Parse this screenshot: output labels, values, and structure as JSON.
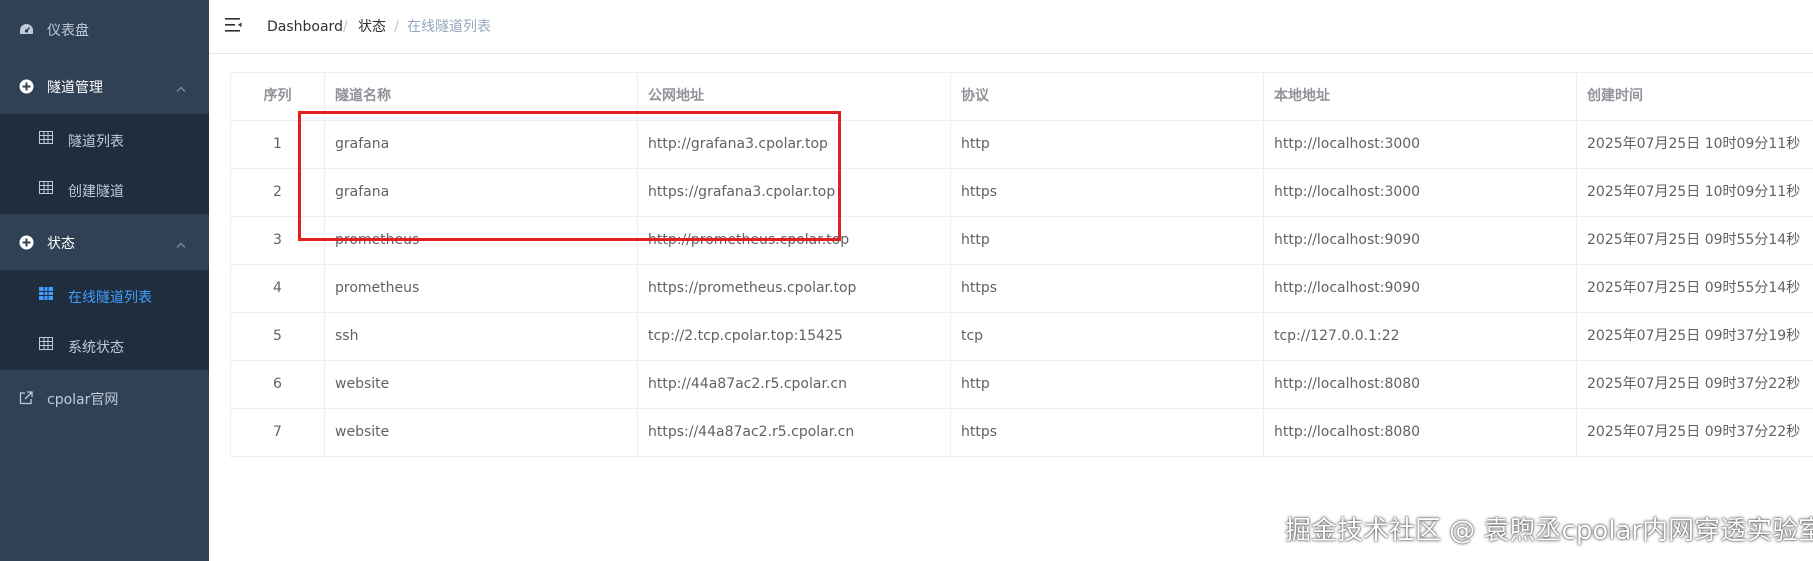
{
  "sidebar": {
    "dashboard": {
      "label": "仪表盘",
      "icon": "dashboard-icon"
    },
    "tunnel_mgmt": {
      "label": "隧道管理",
      "icon": "plus-circle-icon",
      "expanded": true
    },
    "tunnel_list": {
      "label": "隧道列表",
      "icon": "table-icon"
    },
    "create_tunnel": {
      "label": "创建隧道",
      "icon": "table-icon"
    },
    "status": {
      "label": "状态",
      "icon": "plus-circle-icon",
      "expanded": true
    },
    "online_tunnels": {
      "label": "在线隧道列表",
      "icon": "table-icon",
      "active": true
    },
    "system_status": {
      "label": "系统状态",
      "icon": "table-icon"
    },
    "cpolar_site": {
      "label": "cpolar官网",
      "icon": "external-link-icon"
    }
  },
  "header": {
    "breadcrumb": [
      "Dashboard",
      "状态",
      "在线隧道列表"
    ]
  },
  "table": {
    "columns": [
      "序列",
      "隧道名称",
      "公网地址",
      "协议",
      "本地地址",
      "创建时间"
    ],
    "rows": [
      [
        "1",
        "grafana",
        "http://grafana3.cpolar.top",
        "http",
        "http://localhost:3000",
        "2025年07月25日 10时09分11秒"
      ],
      [
        "2",
        "grafana",
        "https://grafana3.cpolar.top",
        "https",
        "http://localhost:3000",
        "2025年07月25日 10时09分11秒"
      ],
      [
        "3",
        "prometheus",
        "http://prometheus.cpolar.top",
        "http",
        "http://localhost:9090",
        "2025年07月25日 09时55分14秒"
      ],
      [
        "4",
        "prometheus",
        "https://prometheus.cpolar.top",
        "https",
        "http://localhost:9090",
        "2025年07月25日 09时55分14秒"
      ],
      [
        "5",
        "ssh",
        "tcp://2.tcp.cpolar.top:15425",
        "tcp",
        "tcp://127.0.0.1:22",
        "2025年07月25日 09时37分19秒"
      ],
      [
        "6",
        "website",
        "http://44a87ac2.r5.cpolar.cn",
        "http",
        "http://localhost:8080",
        "2025年07月25日 09时37分22秒"
      ],
      [
        "7",
        "website",
        "https://44a87ac2.r5.cpolar.cn",
        "https",
        "http://localhost:8080",
        "2025年07月25日 09时37分22秒"
      ]
    ]
  },
  "watermark": "掘金技术社区 @ 袁煦丞cpolar内网穿透实验室",
  "colors": {
    "sidebar_bg": "#304156",
    "submenu_bg": "#1f2d3d",
    "sidebar_text": "#bfcbd9",
    "active": "#409eff",
    "highlight_box": "#e02020"
  }
}
